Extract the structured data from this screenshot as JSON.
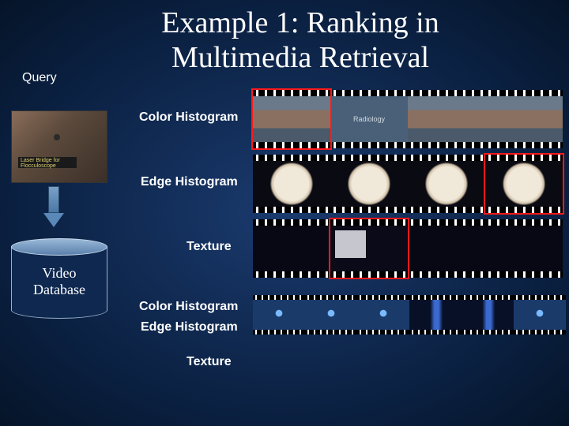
{
  "title_line1": "Example 1: Ranking in",
  "title_line2": "Multimedia Retrieval",
  "query_label": "Query",
  "query_image_caption": "Laser Bridge for Flocculoscope",
  "video_db_line1": "Video",
  "video_db_line2": "Database",
  "features": {
    "color_histogram": "Color Histogram",
    "edge_histogram": "Edge Histogram",
    "texture": "Texture"
  },
  "rows": {
    "color_histogram": {
      "label": "Color Histogram",
      "thumbs": [
        "talking-person",
        "radiology-title",
        "talking-person",
        "talking-person"
      ],
      "highlighted_index": 0
    },
    "edge_histogram": {
      "label": "Edge Histogram",
      "thumbs": [
        "endoscope-round",
        "endoscope-round",
        "endoscope-round",
        "endoscope-round"
      ],
      "highlighted_index": 3
    },
    "texture": {
      "label": "Texture",
      "thumbs": [
        "dark-texture",
        "dark-texture-card",
        "dark-texture",
        "dark-texture"
      ],
      "highlighted_index": 1
    },
    "combined": {
      "labels": [
        "Color Histogram",
        "Edge Histogram",
        "Texture"
      ],
      "thumbs": [
        "blue-dot",
        "blue-dot",
        "blue-dot",
        "blue-vertical",
        "blue-vertical",
        "blue-dot"
      ]
    }
  }
}
